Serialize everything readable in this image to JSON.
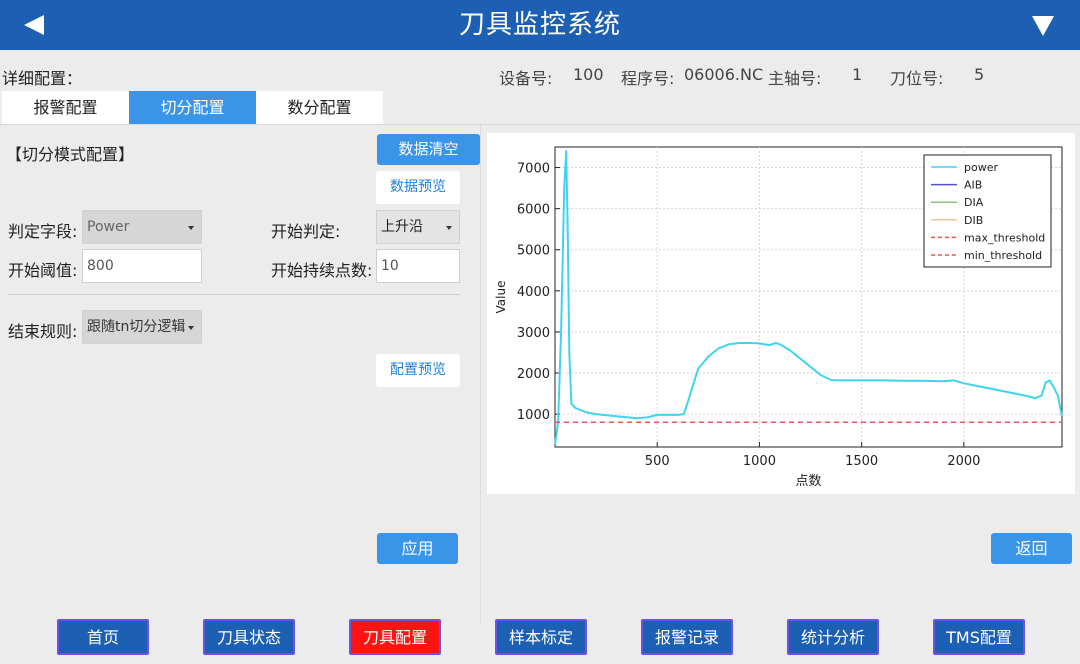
{
  "header": {
    "title": "刀具监控系统",
    "back_icon": "back-triangle-icon",
    "menu_icon": "dropdown-triangle-icon",
    "bar_color": "#1c5fb3"
  },
  "detail_label": "详细配置：",
  "info": {
    "device_label": "设备号:",
    "device_value": "100",
    "program_label": "程序号:",
    "program_value": "06006.NC",
    "spindle_label": "主轴号:",
    "spindle_value": "1",
    "tool_pos_label": "刀位号:",
    "tool_pos_value": "5"
  },
  "tabs": [
    {
      "label": "报警配置",
      "active": false
    },
    {
      "label": "切分配置",
      "active": true
    },
    {
      "label": "数分配置",
      "active": false
    }
  ],
  "config": {
    "section_title": "【切分模式配置】",
    "clear_button": "数据清空",
    "preview_data_button": "数据预览",
    "field_label": "判定字段:",
    "field_value": "Power",
    "start_judge_label": "开始判定:",
    "start_judge_value": "上升沿",
    "start_threshold_label": "开始阈值:",
    "start_threshold_value": "800",
    "start_points_label": "开始持续点数:",
    "start_points_value": "10",
    "end_rule_label": "结束规则:",
    "end_rule_value": "跟随tn切分逻辑",
    "preview_config_button": "配置预览",
    "apply_button": "应用"
  },
  "back_button": "返回",
  "nav": [
    {
      "label": "首页",
      "active": false
    },
    {
      "label": "刀具状态",
      "active": false
    },
    {
      "label": "刀具配置",
      "active": true
    },
    {
      "label": "样本标定",
      "active": false
    },
    {
      "label": "报警记录",
      "active": false
    },
    {
      "label": "统计分析",
      "active": false
    },
    {
      "label": "TMS配置",
      "active": false
    }
  ],
  "chart_data": {
    "type": "line",
    "xlabel": "点数",
    "ylabel": "Value",
    "xlim": [
      0,
      2480
    ],
    "ylim": [
      200,
      7500
    ],
    "xticks": [
      500,
      1000,
      1500,
      2000
    ],
    "yticks": [
      1000,
      2000,
      3000,
      4000,
      5000,
      6000,
      7000
    ],
    "grid": true,
    "legend_position": "top-right",
    "series": [
      {
        "name": "power",
        "color": "#3fd4ee",
        "dash": false,
        "x": [
          0,
          15,
          30,
          45,
          55,
          62,
          70,
          80,
          100,
          150,
          200,
          300,
          400,
          450,
          500,
          600,
          630,
          650,
          700,
          750,
          800,
          850,
          900,
          950,
          1000,
          1050,
          1080,
          1100,
          1150,
          1200,
          1250,
          1300,
          1350,
          1400,
          1500,
          1600,
          1700,
          1800,
          1900,
          1950,
          2000,
          2100,
          2200,
          2300,
          2350,
          2380,
          2400,
          2420,
          2440,
          2460,
          2480
        ],
        "y": [
          250,
          800,
          3000,
          6500,
          7400,
          5500,
          2500,
          1250,
          1150,
          1050,
          1000,
          950,
          900,
          920,
          980,
          980,
          1000,
          1300,
          2100,
          2400,
          2600,
          2700,
          2730,
          2730,
          2720,
          2680,
          2730,
          2700,
          2550,
          2350,
          2150,
          1950,
          1830,
          1820,
          1820,
          1820,
          1810,
          1810,
          1800,
          1820,
          1750,
          1650,
          1550,
          1450,
          1390,
          1450,
          1770,
          1820,
          1650,
          1450,
          950
        ]
      },
      {
        "name": "AIB",
        "color": "#4f4fd8",
        "dash": false,
        "x": [],
        "y": []
      },
      {
        "name": "DIA",
        "color": "#88c878",
        "dash": false,
        "x": [],
        "y": []
      },
      {
        "name": "DIB",
        "color": "#e8c89a",
        "dash": false,
        "x": [],
        "y": []
      },
      {
        "name": "max_threshold",
        "color": "#e65454",
        "dash": true,
        "x": [
          0,
          2480
        ],
        "y": [
          800,
          800
        ]
      },
      {
        "name": "min_threshold",
        "color": "#e65454",
        "dash": true,
        "x": [
          0,
          2480
        ],
        "y": [
          800,
          800
        ]
      }
    ]
  }
}
